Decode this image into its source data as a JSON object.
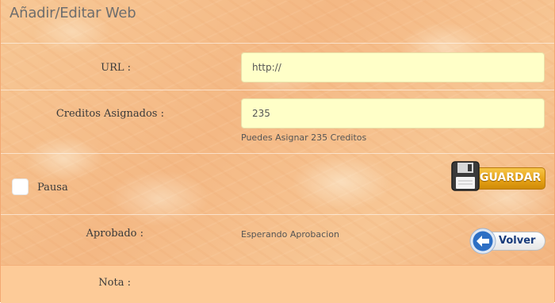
{
  "page": {
    "title": "Añadir/Editar Web"
  },
  "form": {
    "url": {
      "label": "URL :",
      "value": "http://"
    },
    "credits": {
      "label": "Creditos Asignados :",
      "value": "235",
      "hint": "Puedes Asignar 235 Creditos"
    },
    "pause": {
      "label": "Pausa",
      "checked": false
    },
    "approved": {
      "label": "Aprobado :",
      "status": "Esperando Aprobacion"
    },
    "note": {
      "label": "Nota :"
    }
  },
  "buttons": {
    "save": {
      "label": "GUARDAR",
      "icon": "floppy-disk-icon"
    },
    "back": {
      "label": "Volver",
      "icon": "back-arrow-icon"
    }
  },
  "colors": {
    "background": "#f4b884",
    "field_background": "#ffffc8",
    "save_button": "#e8a417",
    "back_arrow": "#2d6fc4",
    "note_band": "#fdcb98"
  }
}
